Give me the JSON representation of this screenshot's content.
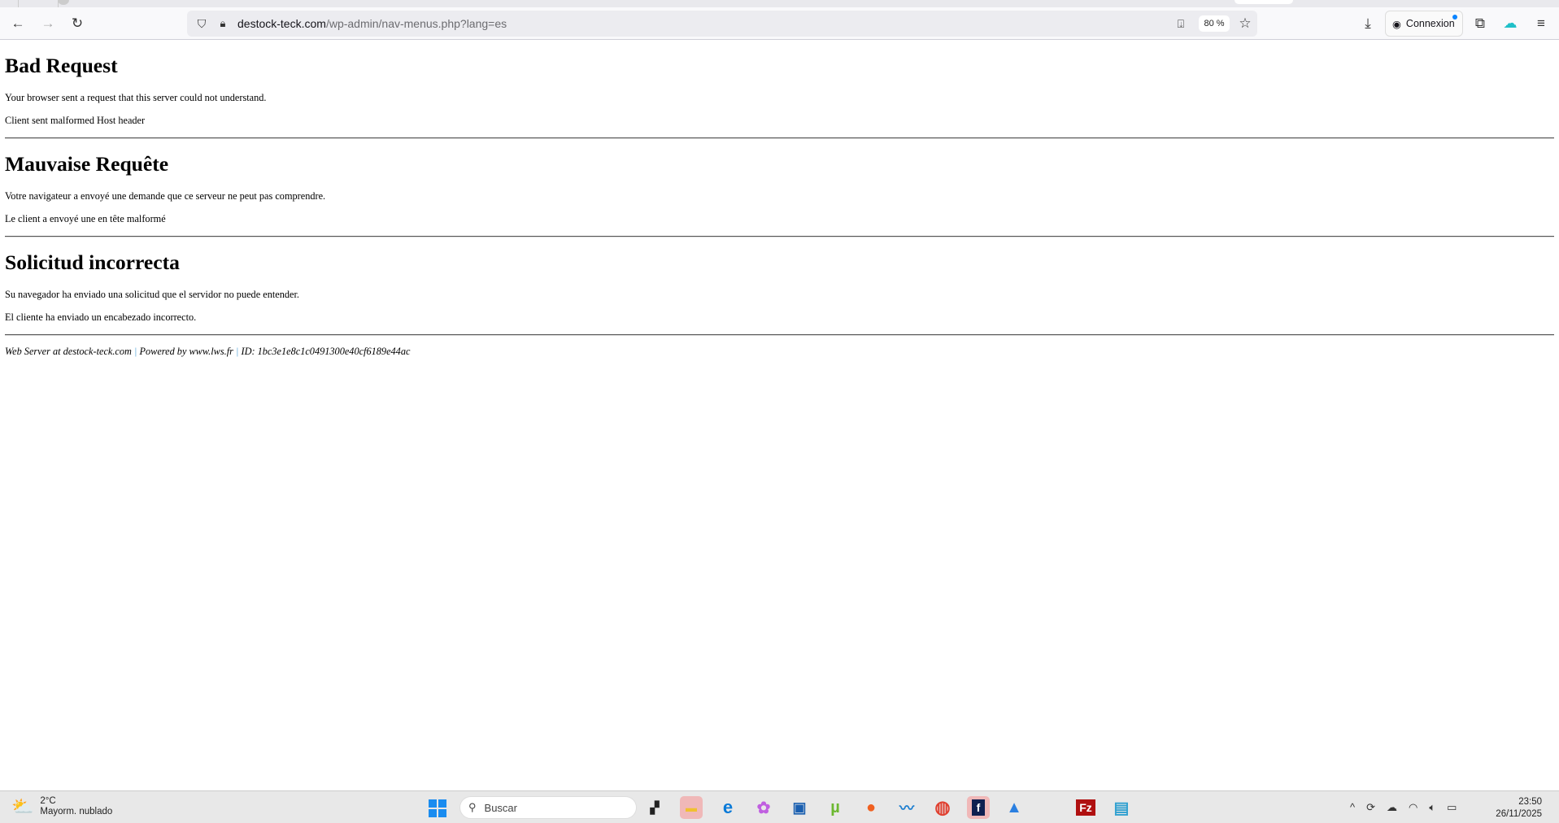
{
  "browser": {
    "url_host": "destock-teck.com",
    "url_path": "/wp-admin/nav-menus.php?lang=es",
    "zoom": "80 %",
    "signin_label": "Connexion"
  },
  "page": {
    "sections": [
      {
        "title": "Bad Request",
        "line1": "Your browser sent a request that this server could not understand.",
        "line2": "Client sent malformed Host header"
      },
      {
        "title": "Mauvaise Requête",
        "line1": "Votre navigateur a envoyé une demande que ce serveur ne peut pas comprendre.",
        "line2": "Le client a envoyé une en tête malformé"
      },
      {
        "title": "Solicitud incorrecta",
        "line1": "Su navegador ha enviado una solicitud que el servidor no puede entender.",
        "line2": "El cliente ha enviado un encabezado incorrecto."
      }
    ],
    "footer": {
      "server": "Web Server at destock-teck.com",
      "powered": "Powered by www.lws.fr",
      "id": "ID: 1bc3e1e8c1c0491300e40cf6189e44ac",
      "sep": "|"
    }
  },
  "taskbar": {
    "weather_temp": "2°C",
    "weather_desc": "Mayorm. nublado",
    "search_placeholder": "Buscar",
    "time": "23:50",
    "date": "26/11/2025"
  }
}
